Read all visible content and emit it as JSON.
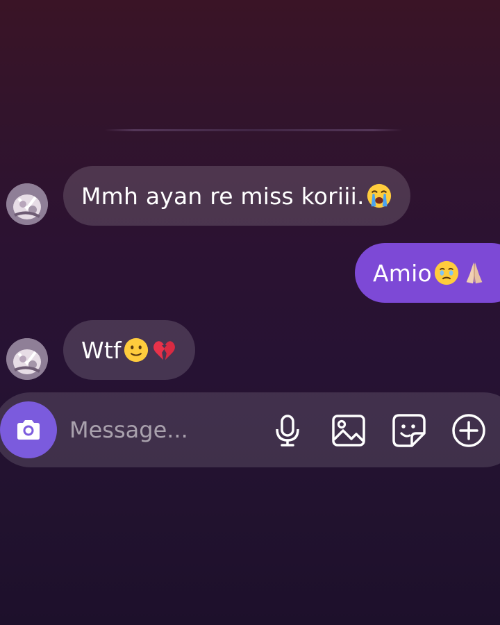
{
  "conversation": {
    "messages": [
      {
        "direction": "incoming",
        "text": "Mmh ayan re miss koriii.",
        "emojis": [
          "loudly-crying-face"
        ]
      },
      {
        "direction": "outgoing",
        "text": "Amio",
        "emojis": [
          "face-holding-back-tears",
          "folded-hands"
        ]
      },
      {
        "direction": "incoming",
        "text": "Wtf",
        "emojis": [
          "slightly-smiling-face",
          "broken-heart"
        ]
      }
    ]
  },
  "composer": {
    "placeholder": "Message...",
    "camera_icon": "camera-icon",
    "actions": [
      "microphone-icon",
      "image-icon",
      "sticker-icon",
      "plus-circle-icon"
    ]
  },
  "colors": {
    "outgoing_bubble": "#7d49d6",
    "camera_button": "#7b5bdd",
    "background_top": "#3a1426",
    "background_bottom": "#1d102b"
  }
}
